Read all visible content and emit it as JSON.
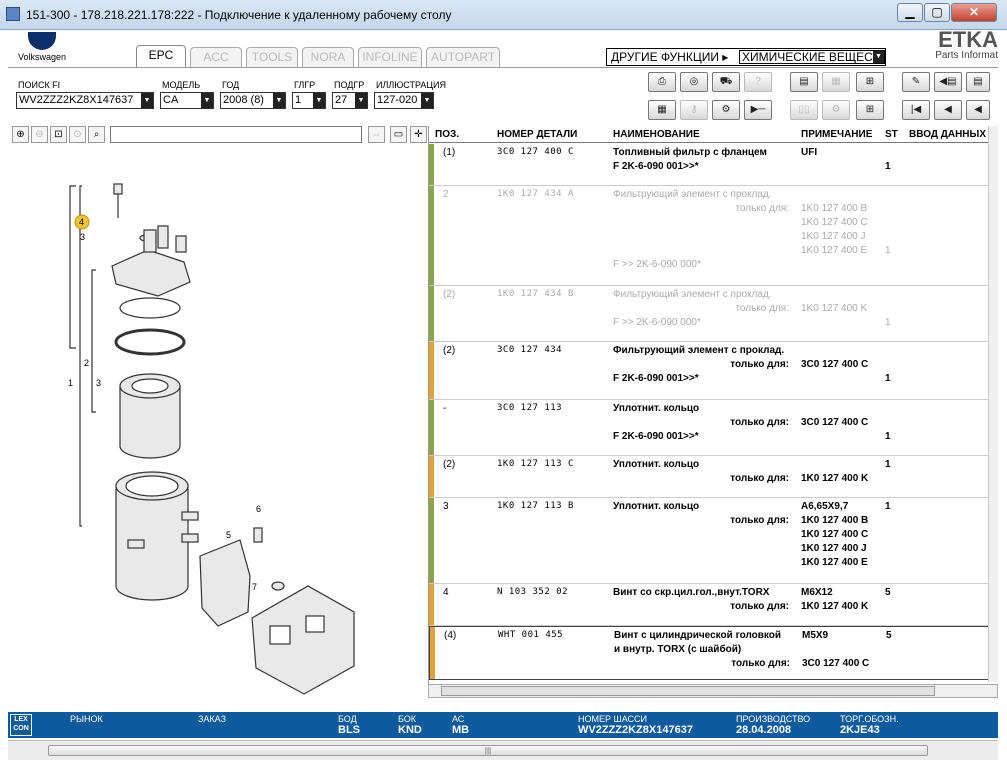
{
  "window": {
    "title": "151-300 - 178.218.221.178:222 - Подключение к удаленному рабочему столу",
    "minimize": "▁",
    "maximize": "▢",
    "close": "✕"
  },
  "brand": {
    "name": "Volkswagen",
    "etka_title": "ETKA",
    "etka_sub": "Parts Informat"
  },
  "tabs": [
    "EPC",
    "ACC",
    "TOOLS",
    "NORA",
    "INFOLINE",
    "AUTOPART"
  ],
  "other_functions": {
    "label": "ДРУГИЕ ФУНКЦИИ ▸",
    "value": "ХИМИЧЕСКИЕ ВЕЩЕС"
  },
  "fields": {
    "vin": {
      "label": "ПОИСК FI",
      "value": "WV2ZZZ2KZ8X147637"
    },
    "model": {
      "label": "МОДЕЛЬ",
      "value": "CA"
    },
    "year": {
      "label": "ГОД",
      "value": "2008 (8)"
    },
    "group": {
      "label": "ГЛГР",
      "value": "1"
    },
    "subgroup": {
      "label": "ПОДГР",
      "value": "27"
    },
    "illustration": {
      "label": "ИЛЛЮСТРАЦИЯ",
      "value": "127-020"
    }
  },
  "toolbar_icons": [
    "print-icon",
    "cd-icon",
    "vehicle-icon",
    "help-icon",
    "elsa-icon",
    "depot-icon",
    "cart-icon",
    "pin-icon",
    "back-list-icon",
    "keyboard-icon",
    "key-icon",
    "engine-icon",
    "play-icon",
    "compare-icon",
    "parts-icon",
    "basket-icon",
    "first-icon",
    "prev-icon",
    "next-icon"
  ],
  "table": {
    "headers": {
      "pos": "ПОЗ.",
      "number": "НОМЕР ДЕТАЛИ",
      "name": "НАИМЕНОВАНИЕ",
      "note": "ПРИМЕЧАНИЕ",
      "st": "ST",
      "input": "ВВОД ДАННЫХ"
    },
    "only_for": "только для:",
    "rows": [
      {
        "pos": "(1)",
        "number": "3C0 127 400 C",
        "name": "Топливный фильтр с фланцем",
        "name2": "F 2K-6-090 001>>*",
        "note": "UFI",
        "st": "1",
        "bar": "#8ea34a"
      },
      {
        "pos": "2",
        "number": "1K0 127 434 A",
        "name": "Фильтрующий элемент с проклад.",
        "notes": [
          "1K0 127 400 B",
          "1K0 127 400 C",
          "1K0 127 400 J",
          "1K0 127 400 E"
        ],
        "st": "1",
        "name2": "F          >> 2K-6-090 000*",
        "bar": "#8ea34a"
      },
      {
        "pos": "(2)",
        "number": "1K0 127 434 B",
        "name": "Фильтрующий элемент с проклад.",
        "notes": [
          "1K0 127 400 K"
        ],
        "st": "1",
        "name2": "F          >> 2K-6-090 000*",
        "bar": "#8ea34a"
      },
      {
        "pos": "(2)",
        "number": "3C0 127 434",
        "name": "Фильтрующий элемент с проклад.",
        "notes": [
          "3C0 127 400 C"
        ],
        "st": "1",
        "name2": "F 2K-6-090 001>>*",
        "bar": "#e0a23a"
      },
      {
        "pos": "-",
        "number": "3C0 127 113",
        "name": "Уплотнит. кольцо",
        "notes": [
          "3C0 127 400 C"
        ],
        "st": "1",
        "name2": "F 2K-6-090 001>>*",
        "bar": "#8ea34a"
      },
      {
        "pos": "(2)",
        "number": "1K0 127 113 C",
        "name": "Уплотнит. кольцо",
        "notes": [
          "1K0 127 400 K"
        ],
        "st": "1",
        "bar": "#e0a23a"
      },
      {
        "pos": "3",
        "number": "1K0 127 113 B",
        "name": "Уплотнит. кольцо",
        "note": "A6,65X9,7",
        "notes": [
          "1K0 127 400 B",
          "1K0 127 400 C",
          "1K0 127 400 J",
          "1K0 127 400 E"
        ],
        "st": "1",
        "bar": "#8ea34a"
      },
      {
        "pos": "4",
        "number": "N  103 352 02",
        "name": "Винт со скр.цил.гол.,внут.TORX",
        "note": "M6X12",
        "notes": [
          "1K0 127 400 K"
        ],
        "st": "5",
        "bar": "#e0a23a"
      },
      {
        "pos": "(4)",
        "number": "WHT 001 455",
        "name": "Винт с цилиндрической головкой",
        "name2": "и внутр. TORX (с шайбой)",
        "note": "M5X9",
        "notes": [
          "3C0 127 400 C"
        ],
        "st": "5",
        "bar": "#e0a23a"
      }
    ]
  },
  "callouts": [
    "4",
    "3",
    "1",
    "2",
    "3",
    "5",
    "6",
    "7"
  ],
  "status": {
    "market": {
      "label": "РЫНОК",
      "value": ""
    },
    "order": {
      "label": "ЗАКАЗ",
      "value": ""
    },
    "bod": {
      "label": "БОД",
      "value": "BLS"
    },
    "kpp": {
      "label": "БОК",
      "value": "KND"
    },
    "ac": {
      "label": "АС",
      "value": "MB"
    },
    "chassis": {
      "label": "НОМЕР ШАССИ",
      "value": "WV2ZZZ2KZ8X147637"
    },
    "production": {
      "label": "ПРОИЗВОДСТВО",
      "value": "28.04.2008"
    },
    "trade": {
      "label": "ТОРГ.ОБОЗН.",
      "value": "2KJE43"
    },
    "lex": "LEX CON"
  }
}
